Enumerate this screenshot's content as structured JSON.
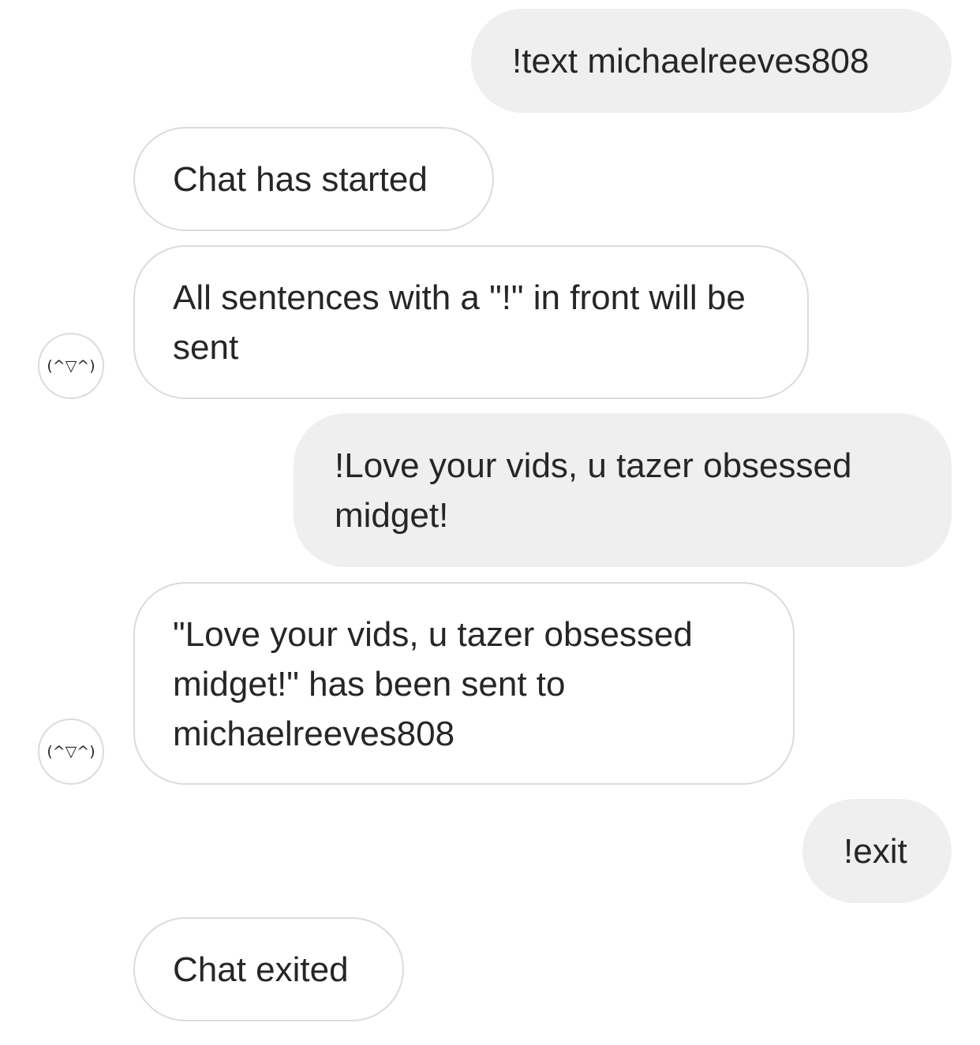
{
  "messages": [
    {
      "id": "b1",
      "direction": "outgoing",
      "text": "!text michaelreeves808"
    },
    {
      "id": "b2",
      "direction": "incoming",
      "text": "Chat has started"
    },
    {
      "id": "b3",
      "direction": "incoming",
      "text": "All sentences with a \"!\" in front will be sent"
    },
    {
      "id": "b4",
      "direction": "outgoing",
      "text": "!Love your vids, u tazer obsessed midget!"
    },
    {
      "id": "b5",
      "direction": "incoming",
      "text": "\"Love your vids, u tazer obsessed midget!\" has been sent to michaelreeves808"
    },
    {
      "id": "b6",
      "direction": "outgoing",
      "text": "!exit"
    },
    {
      "id": "b7",
      "direction": "incoming",
      "text": "Chat exited"
    }
  ],
  "avatars": {
    "bot_face": "(^▽^)"
  },
  "colors": {
    "outgoing_bubble": "#efefef",
    "incoming_border": "#dbdbdb",
    "text": "#262626",
    "background": "#ffffff"
  }
}
